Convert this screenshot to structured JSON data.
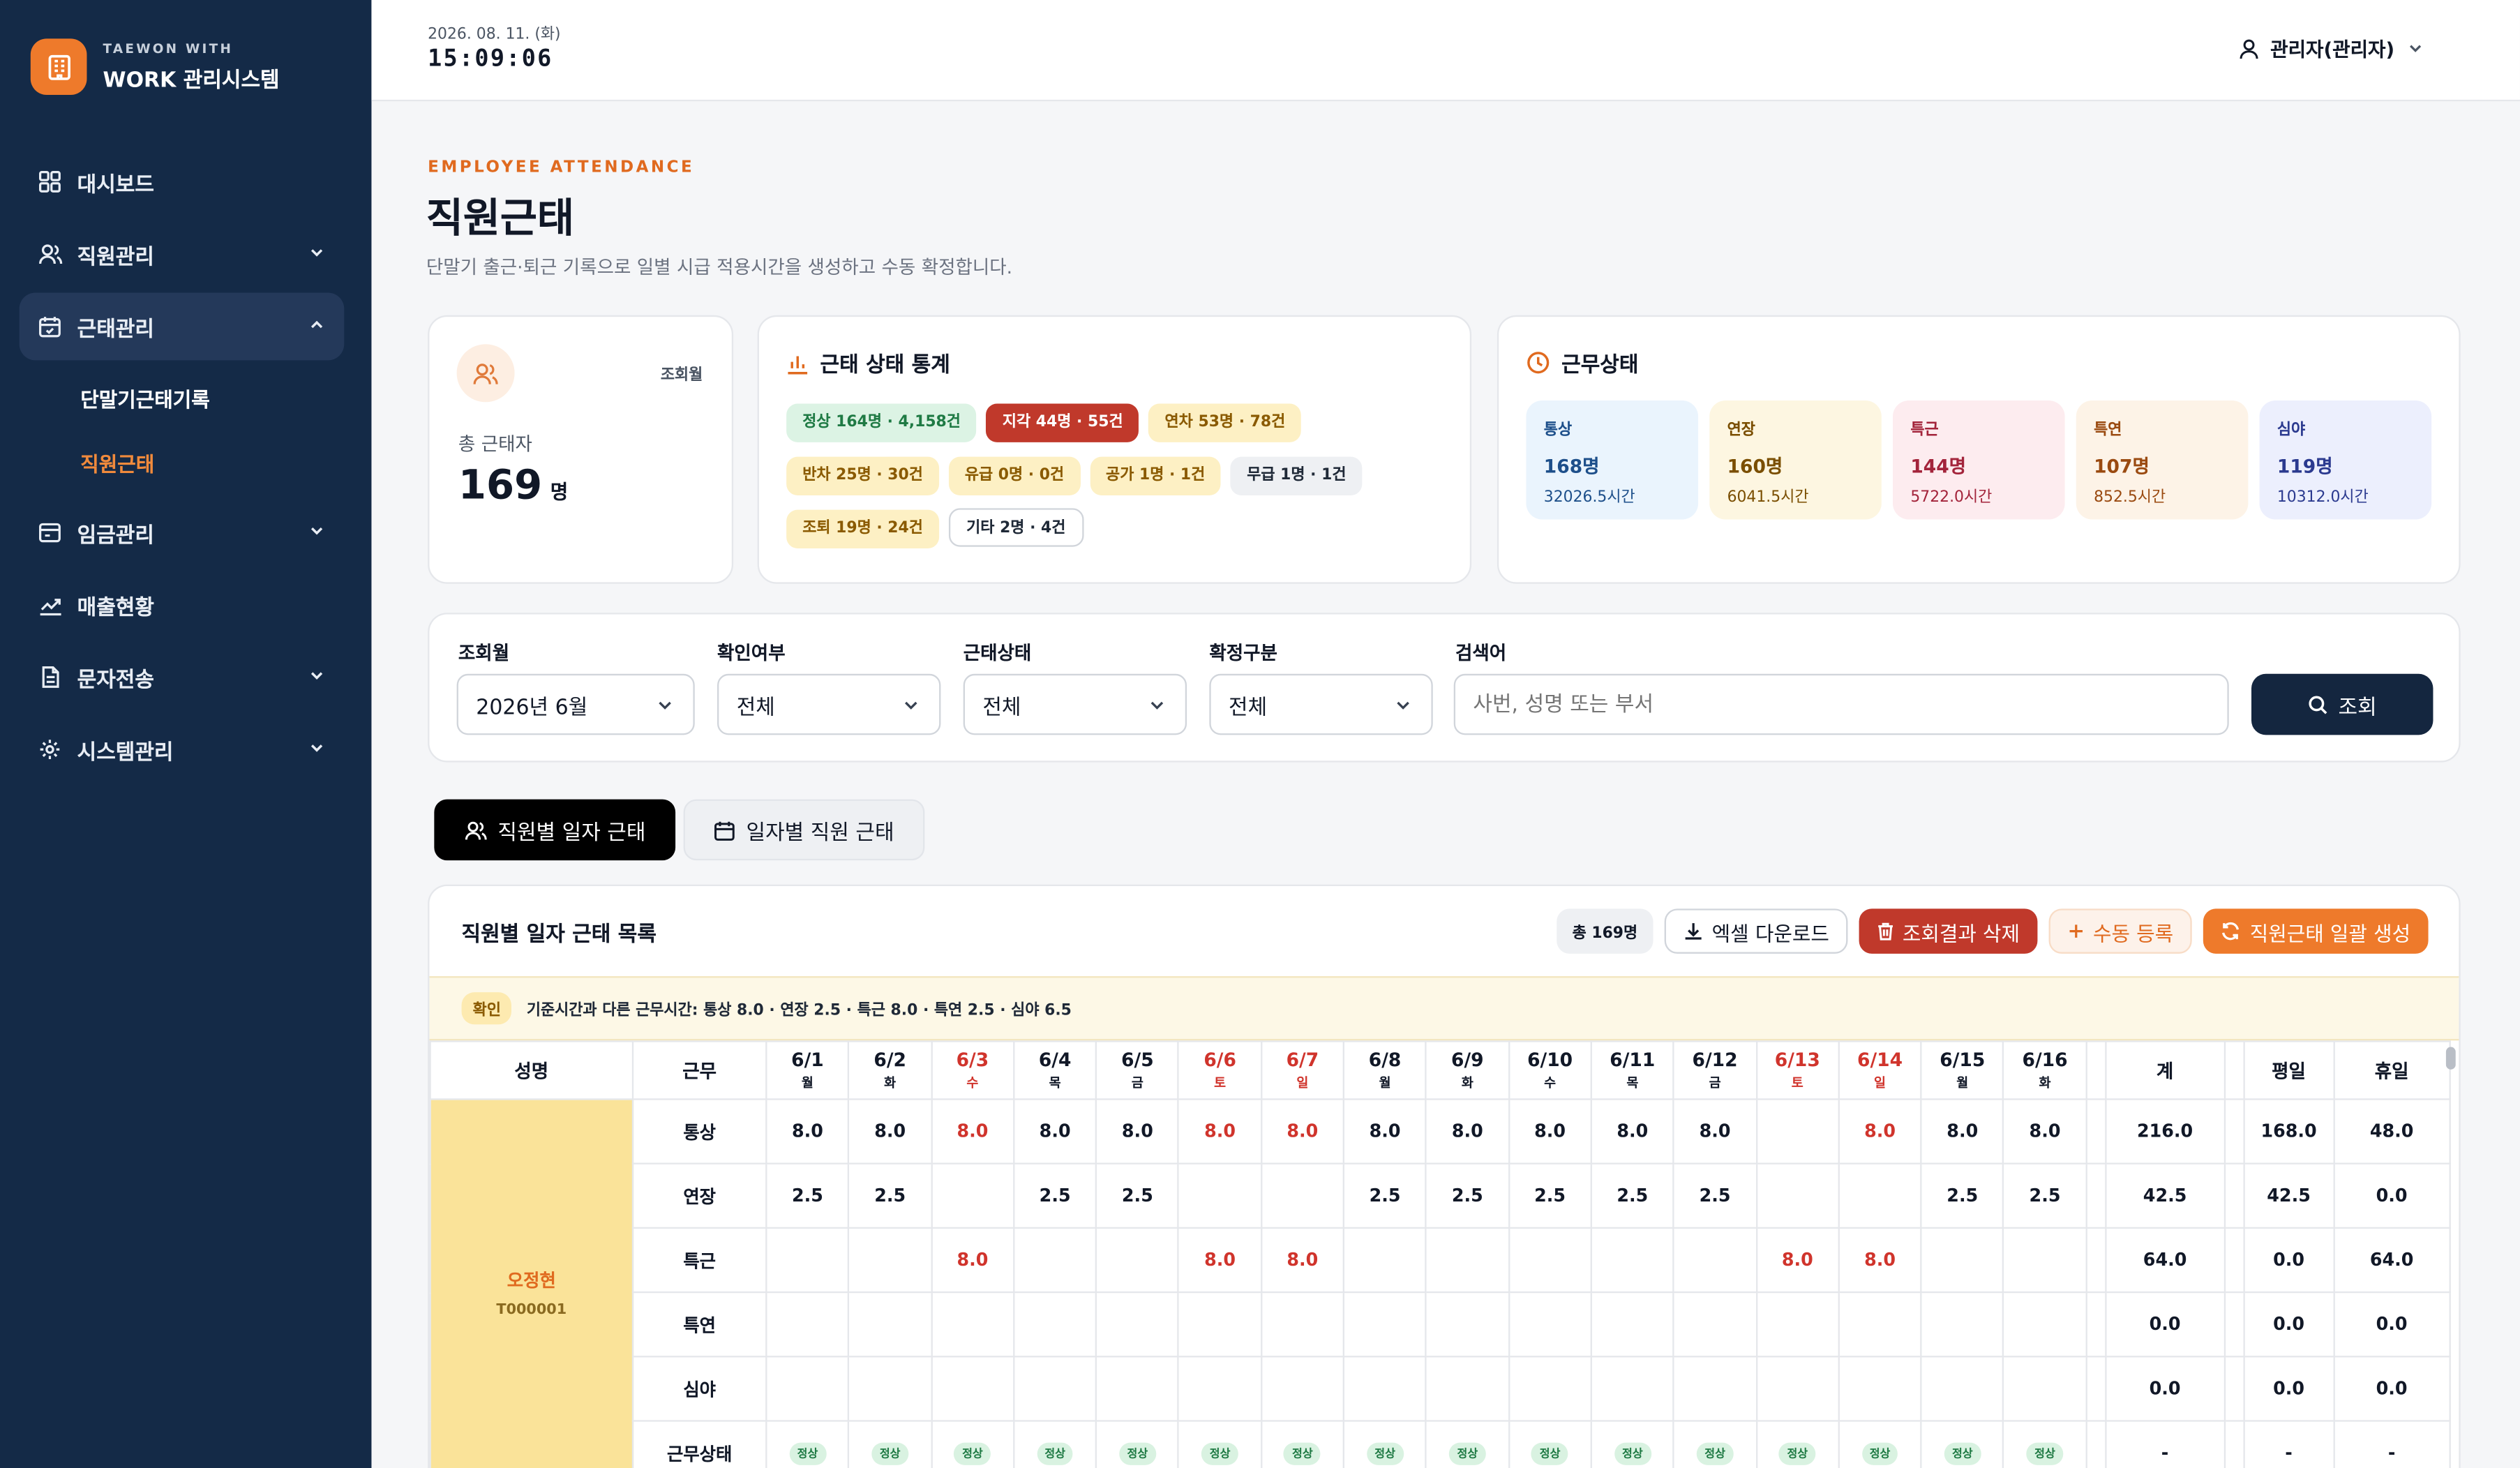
{
  "brand": {
    "sub": "TAEWON WITH",
    "title": "WORK 관리시스템"
  },
  "nav": {
    "dashboard": "대시보드",
    "employee": "직원관리",
    "attendance": "근태관리",
    "attendance_sub": {
      "terminal": "단말기근태기록",
      "employee_att": "직원근태"
    },
    "wage": "임금관리",
    "sales": "매출현황",
    "sms": "문자전송",
    "system": "시스템관리"
  },
  "topbar": {
    "date": "2026. 08. 11. (화)",
    "time": "15:09:06",
    "user": "관리자(관리자)"
  },
  "page": {
    "eyebrow": "EMPLOYEE ATTENDANCE",
    "title": "직원근태",
    "desc": "단말기 출근·퇴근 기록으로 일별 시급 적용시간을 생성하고 수동 확정합니다."
  },
  "summary": {
    "month_label": "조회월",
    "total_label": "총 근태자",
    "total_value": "169",
    "total_unit": "명"
  },
  "stats": {
    "title": "근태 상태 통계",
    "pills": [
      {
        "label": "정상 164명 · 4,158건",
        "bg": "#dcf3e4",
        "fg": "#1f7a44"
      },
      {
        "label": "지각 44명 · 55건",
        "bg": "#c0392b",
        "fg": "#ffffff"
      },
      {
        "label": "연차 53명 · 78건",
        "bg": "#fdf0c4",
        "fg": "#8a5a00"
      },
      {
        "label": "반차 25명 · 30건",
        "bg": "#fdf0c4",
        "fg": "#8a5a00"
      },
      {
        "label": "유급 0명 · 0건",
        "bg": "#fdf0c4",
        "fg": "#8a5a00"
      },
      {
        "label": "공가 1명 · 1건",
        "bg": "#fdf0c4",
        "fg": "#8a5a00"
      },
      {
        "label": "무급 1명 · 1건",
        "bg": "#eef0f3",
        "fg": "#1f2937"
      },
      {
        "label": "조퇴 19명 · 24건",
        "bg": "#fdf0c4",
        "fg": "#8a5a00"
      },
      {
        "label": "기타 2명 · 4건",
        "bg": "#ffffff",
        "fg": "#1f2937"
      }
    ]
  },
  "work_status": {
    "title": "근무상태",
    "items": [
      {
        "label": "통상",
        "count": "168명",
        "hours": "32026.5시간",
        "bg": "#eaf4fd",
        "fg": "#1d4f8a"
      },
      {
        "label": "연장",
        "count": "160명",
        "hours": "6041.5시간",
        "bg": "#fdf6e1",
        "fg": "#7a4e00"
      },
      {
        "label": "특근",
        "count": "144명",
        "hours": "5722.0시간",
        "bg": "#fdecef",
        "fg": "#a3243b"
      },
      {
        "label": "특연",
        "count": "107명",
        "hours": "852.5시간",
        "bg": "#fdf3e7",
        "fg": "#9a4a10"
      },
      {
        "label": "심야",
        "count": "119명",
        "hours": "10312.0시간",
        "bg": "#eceffd",
        "fg": "#2b3a8f"
      }
    ]
  },
  "filters": {
    "month": {
      "label": "조회월",
      "value": "2026년 6월"
    },
    "confirm": {
      "label": "확인여부",
      "value": "전체"
    },
    "status": {
      "label": "근태상태",
      "value": "전체"
    },
    "fixed": {
      "label": "확정구분",
      "value": "전체"
    },
    "search": {
      "label": "검색어",
      "placeholder": "사번, 성명 또는 부서"
    },
    "search_button": "조회"
  },
  "tabs": {
    "by_employee": "직원별 일자 근태",
    "by_day": "일자별 직원 근태"
  },
  "list": {
    "title": "직원별 일자 근태 목록",
    "total": "총 169명",
    "excel": "엑셀 다운로드",
    "delete": "조회결과 삭제",
    "manual": "수동 등록",
    "generate": "직원근태 일괄 생성",
    "notice_badge": "확인",
    "notice": "기준시간과 다른 근무시간: 통상 8.0 · 연장 2.5 · 특근 8.0 · 특연 2.5 · 심야 6.5"
  },
  "table": {
    "col_name": "성명",
    "col_work": "근무",
    "col_total": "계",
    "col_weekday": "평일",
    "col_holiday": "휴일",
    "days": [
      {
        "d": "6/1",
        "w": "월",
        "h": false
      },
      {
        "d": "6/2",
        "w": "화",
        "h": false
      },
      {
        "d": "6/3",
        "w": "수",
        "h": true
      },
      {
        "d": "6/4",
        "w": "목",
        "h": false
      },
      {
        "d": "6/5",
        "w": "금",
        "h": false
      },
      {
        "d": "6/6",
        "w": "토",
        "h": true
      },
      {
        "d": "6/7",
        "w": "일",
        "h": true
      },
      {
        "d": "6/8",
        "w": "월",
        "h": false
      },
      {
        "d": "6/9",
        "w": "화",
        "h": false
      },
      {
        "d": "6/10",
        "w": "수",
        "h": false
      },
      {
        "d": "6/11",
        "w": "목",
        "h": false
      },
      {
        "d": "6/12",
        "w": "금",
        "h": false
      },
      {
        "d": "6/13",
        "w": "토",
        "h": true
      },
      {
        "d": "6/14",
        "w": "일",
        "h": true
      },
      {
        "d": "6/15",
        "w": "월",
        "h": false
      },
      {
        "d": "6/16",
        "w": "화",
        "h": false
      }
    ],
    "employee": {
      "name": "오정현",
      "id": "T000001"
    },
    "rows": [
      {
        "type": "통상",
        "cells": [
          "8.0",
          "8.0",
          "8.0",
          "8.0",
          "8.0",
          "8.0",
          "8.0",
          "8.0",
          "8.0",
          "8.0",
          "8.0",
          "8.0",
          "",
          "8.0",
          "8.0",
          "8.0"
        ],
        "total": "216.0",
        "weekday": "168.0",
        "holiday": "48.0"
      },
      {
        "type": "연장",
        "cells": [
          "2.5",
          "2.5",
          "",
          "2.5",
          "2.5",
          "",
          "",
          "2.5",
          "2.5",
          "2.5",
          "2.5",
          "2.5",
          "",
          "",
          "2.5",
          "2.5"
        ],
        "total": "42.5",
        "weekday": "42.5",
        "holiday": "0.0"
      },
      {
        "type": "특근",
        "cells": [
          "",
          "",
          "8.0",
          "",
          "",
          "8.0",
          "8.0",
          "",
          "",
          "",
          "",
          "",
          "8.0",
          "8.0",
          "",
          ""
        ],
        "total": "64.0",
        "weekday": "0.0",
        "holiday": "64.0"
      },
      {
        "type": "특연",
        "cells": [
          "",
          "",
          "",
          "",
          "",
          "",
          "",
          "",
          "",
          "",
          "",
          "",
          "",
          "",
          "",
          ""
        ],
        "total": "0.0",
        "weekday": "0.0",
        "holiday": "0.0"
      },
      {
        "type": "심야",
        "cells": [
          "",
          "",
          "",
          "",
          "",
          "",
          "",
          "",
          "",
          "",
          "",
          "",
          "",
          "",
          "",
          ""
        ],
        "total": "0.0",
        "weekday": "0.0",
        "holiday": "0.0"
      }
    ],
    "status_row": {
      "type": "근무상태",
      "cell": "정상",
      "total": "-",
      "weekday": "-",
      "holiday": "-"
    }
  }
}
